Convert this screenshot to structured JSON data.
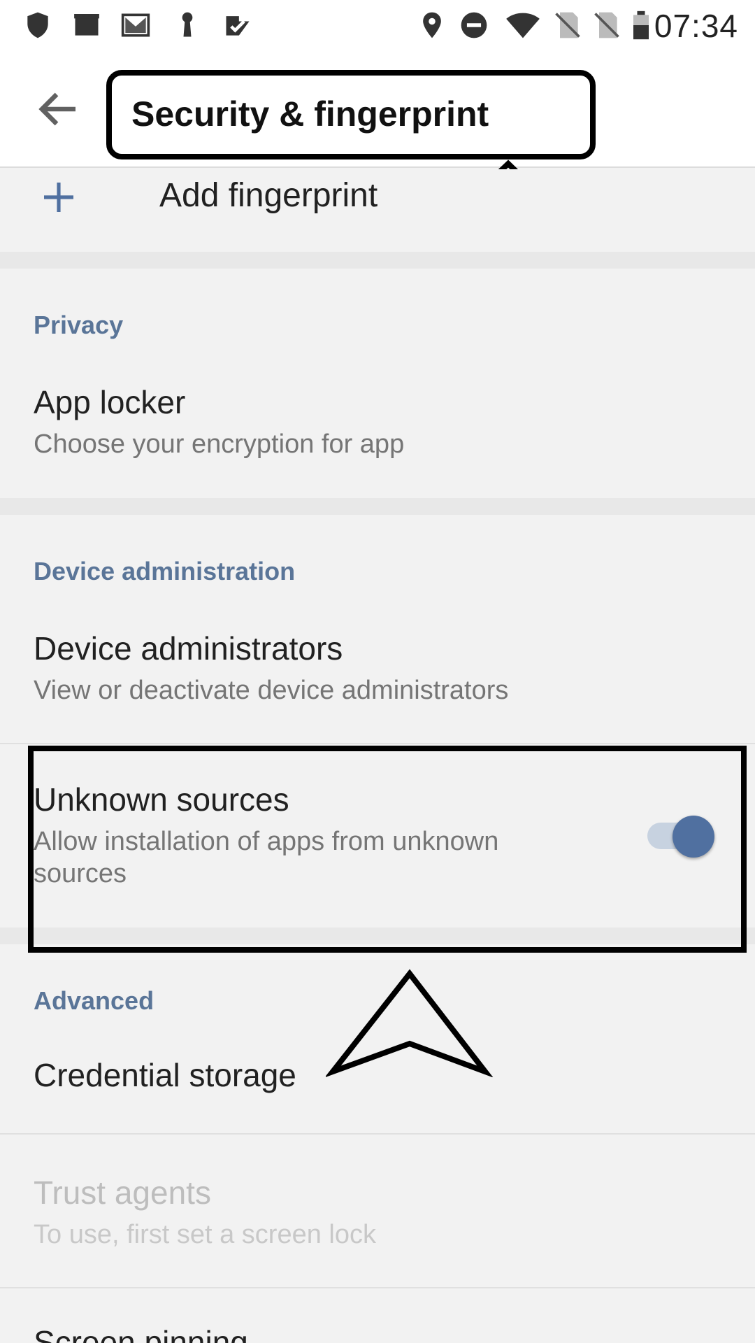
{
  "status_bar": {
    "time": "07:34",
    "left_icons": [
      "shield-icon",
      "clapper-icon",
      "gmail-icon",
      "keyhole-icon",
      "task-check-icon"
    ],
    "right_icons": [
      "location-icon",
      "do-not-disturb-icon",
      "wifi-icon",
      "no-sim-icon",
      "no-sim-icon",
      "battery-icon"
    ]
  },
  "app_bar": {
    "back_icon": "arrow-left-icon",
    "title": "Security & fingerprint"
  },
  "items": {
    "add_fingerprint": {
      "icon": "plus-icon",
      "label": "Add fingerprint"
    },
    "privacy": {
      "section": "Privacy",
      "app_locker_title": "App locker",
      "app_locker_sub": "Choose your encryption for app"
    },
    "device_admin": {
      "section": "Device administration",
      "admins_title": "Device administrators",
      "admins_sub": "View or deactivate device administrators",
      "unknown_title": "Unknown sources",
      "unknown_sub_line1": "Allow installation of apps from unknown",
      "unknown_sub_line2": "sources",
      "unknown_toggle_on": true
    },
    "advanced": {
      "section": "Advanced",
      "credential_title": "Credential storage",
      "trust_title": "Trust agents",
      "trust_sub": "To use, first set a screen lock",
      "pinning_title": "Screen pinning"
    }
  },
  "colors": {
    "accent": "#5070a0",
    "section_label": "#5a7598",
    "background": "#f2f2f2"
  }
}
